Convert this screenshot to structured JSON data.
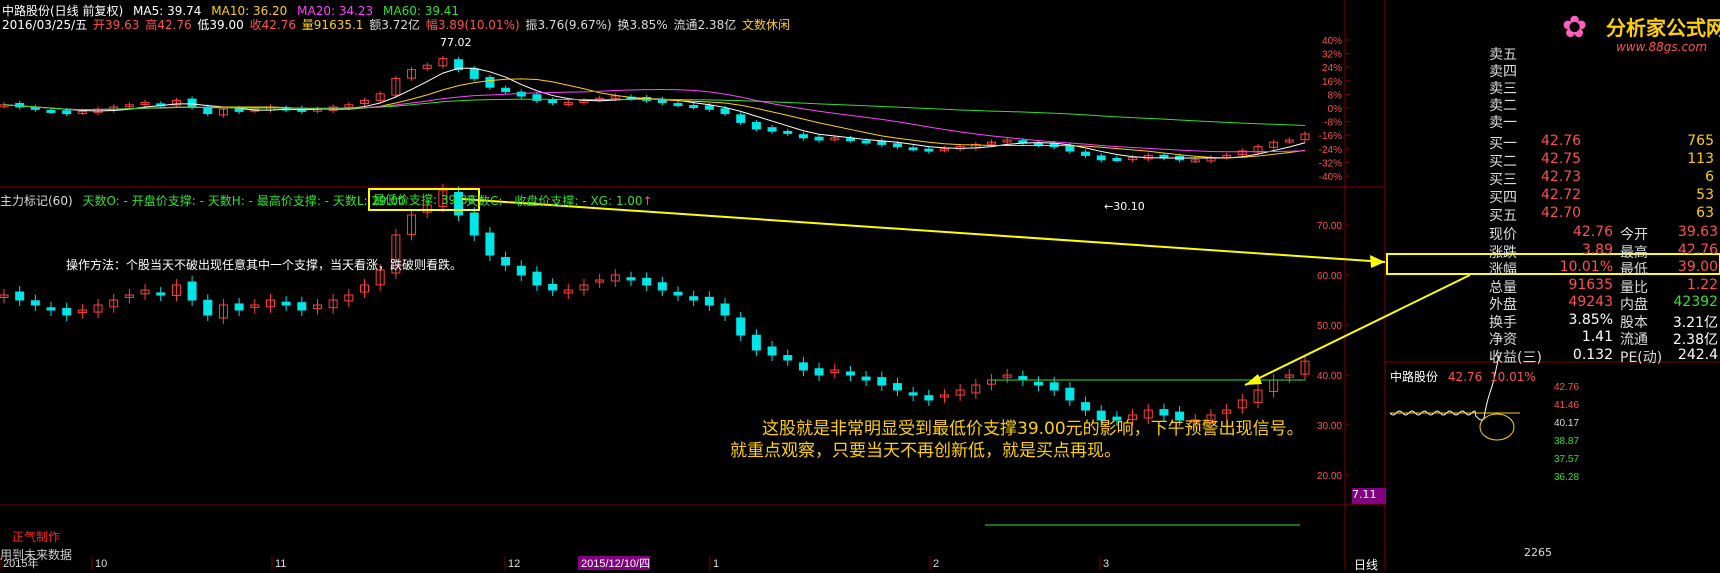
{
  "header": {
    "stock_title": "中路股份(日线 前复权)",
    "ma5": "MA5: 39.74",
    "ma10": "MA10: 36.20",
    "ma20": "MA20: 34.23",
    "ma60": "MA60: 39.41",
    "date_line": "2016/03/25/五",
    "open": "开39.63",
    "high": "高42.76",
    "low": "低39.00",
    "close": "收42.76",
    "vol": "量91635.1",
    "amount": "额3.72亿",
    "change": "幅3.89(10.01%)",
    "amplitude": "振3.76(9.67%)",
    "turnover": "换3.85%",
    "float": "流通2.38亿",
    "news": "文数休闲"
  },
  "indicator": {
    "name": "主力标记(60)",
    "days_o": "天数O: -",
    "open_support": "开盘价支撑: -",
    "days_h": "天数H: -",
    "high_support": "最高价支撑: -",
    "days_l": "天数L: 29.00",
    "low_support": "最低价支撑: 39.00",
    "days_c": "天数C: -",
    "close_support": "收盘价支撑: -",
    "xg": "XG: 1.00"
  },
  "notes": {
    "method": "操作方法：个股当天不破出现任意其中一个支撑，当天看涨，跌破则看跌。",
    "line1": "这股就是非常明显受到最低价支撑39.00元的影响，下午预警出现信号。",
    "line2": "就重点观察，只要当天不再创新低，就是买点再现。",
    "author": "正气制作",
    "future": "用到未来数据"
  },
  "logo": {
    "text": "分析家公式网",
    "url": "www.88gs.com"
  },
  "labels": {
    "peak": "77.02",
    "trough": "←30.10",
    "tab": "日线",
    "mini_title": "中路股份",
    "mini_price": "42.76",
    "mini_pct": "10.01%",
    "mini_vol": "2265",
    "purple_box": "7.11"
  },
  "axis": {
    "pct_ticks": [
      "40%",
      "32%",
      "24%",
      "16%",
      "8%",
      "0%",
      "-8%",
      "-16%",
      "-24%",
      "-32%",
      "-40%"
    ],
    "price_ticks": [
      "70.00",
      "60.00",
      "50.00",
      "40.00",
      "30.00",
      "20.00"
    ],
    "mini_ticks": [
      "42.76",
      "41.46",
      "40.17",
      "38.87",
      "37.57",
      "36.28"
    ],
    "months": [
      "2015年",
      "10",
      "11",
      "12",
      "2015/12/10/四",
      "1",
      "2",
      "3"
    ]
  },
  "quotes": {
    "sells": [
      "卖五",
      "卖四",
      "卖三",
      "卖二",
      "卖一"
    ],
    "buys": [
      {
        "label": "买一",
        "price": "42.76",
        "vol": "765"
      },
      {
        "label": "买二",
        "price": "42.75",
        "vol": "113"
      },
      {
        "label": "买三",
        "price": "42.73",
        "vol": "6"
      },
      {
        "label": "买四",
        "price": "42.72",
        "vol": "53"
      },
      {
        "label": "买五",
        "price": "42.70",
        "vol": "63"
      }
    ],
    "stats": [
      {
        "l1": "现价",
        "v1": "42.76",
        "l2": "今开",
        "v2": "39.63"
      },
      {
        "l1": "涨跌",
        "v1": "3.89",
        "l2": "最高",
        "v2": "42.76"
      },
      {
        "l1": "涨幅",
        "v1": "10.01%",
        "l2": "最低",
        "v2": "39.00"
      },
      {
        "l1": "总量",
        "v1": "91635",
        "l2": "量比",
        "v2": "1.22"
      },
      {
        "l1": "外盘",
        "v1": "49243",
        "l2": "内盘",
        "v2": "42392"
      },
      {
        "l1": "换手",
        "v1": "3.85%",
        "l2": "股本",
        "v2": "3.21亿"
      },
      {
        "l1": "净资",
        "v1": "1.41",
        "l2": "流通",
        "v2": "2.38亿"
      },
      {
        "l1": "收益(三)",
        "v1": "0.132",
        "l2": "PE(动)",
        "v2": "242.4"
      }
    ]
  },
  "chart_data": {
    "type": "candlestick",
    "x_range": [
      "2015/08",
      "2016/03/25"
    ],
    "pct_axis_ylim": [
      -40,
      40
    ],
    "price_axis_ylim": [
      15,
      75
    ],
    "series": [
      {
        "name": "K线",
        "ohlc_close": [
          56,
          55,
          54,
          53,
          52,
          53,
          54,
          55,
          56,
          57,
          56,
          58,
          55,
          52,
          54,
          53,
          54,
          55,
          54,
          53,
          54,
          55,
          56,
          58,
          61,
          68,
          72,
          74,
          77,
          72,
          68,
          64,
          62,
          60,
          58,
          57,
          57,
          58,
          59,
          60,
          59,
          58,
          57,
          56,
          55,
          54,
          52,
          48,
          45,
          44,
          43,
          41,
          40,
          41,
          40,
          39,
          38,
          37,
          36,
          35,
          36,
          37,
          38,
          39,
          40,
          39,
          38,
          37,
          35,
          33,
          31,
          31,
          32,
          33,
          32,
          31,
          31,
          32,
          33,
          35,
          37,
          39,
          40,
          42.76
        ]
      }
    ],
    "annotations": {
      "high": 77.02,
      "low": 30.1,
      "support": 39.0
    }
  }
}
